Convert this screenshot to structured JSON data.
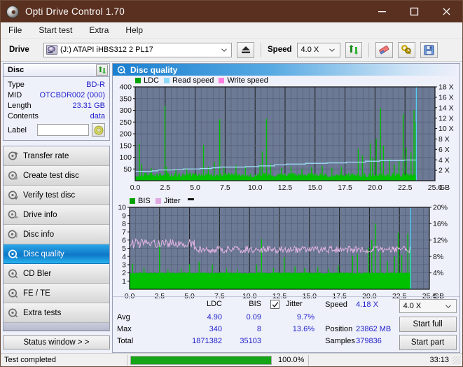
{
  "window": {
    "title": "Opti Drive Control 1.70",
    "icon": "disc-icon",
    "minimize": "minimize-icon",
    "maximize": "maximize-icon",
    "close": "close-icon"
  },
  "menu": {
    "items": [
      "File",
      "Start test",
      "Extra",
      "Help"
    ]
  },
  "toolbar": {
    "drive_label": "Drive",
    "drive_value": "(J:)   ATAPI iHBS312   2 PL17",
    "eject_icon": "eject-icon",
    "speed_label": "Speed",
    "speed_value": "4.0 X",
    "refresh_icon": "refresh-icon",
    "erase_icon": "eraser-icon",
    "tools_icon": "wrench-icon",
    "save_icon": "floppy-save-icon"
  },
  "disc_panel": {
    "title": "Disc",
    "refresh_icon": "refresh-icon",
    "rows": [
      {
        "key": "Type",
        "value": "BD-R"
      },
      {
        "key": "MID",
        "value": "OTCBDR002 (000)"
      },
      {
        "key": "Length",
        "value": "23.31 GB"
      },
      {
        "key": "Contents",
        "value": "data"
      }
    ],
    "label_key": "Label",
    "label_value": "",
    "label_button_icon": "cd-icon"
  },
  "sidebar": {
    "items": [
      {
        "label": "Transfer rate",
        "icon": "disc-transfer-icon",
        "selected": false
      },
      {
        "label": "Create test disc",
        "icon": "disc-create-icon",
        "selected": false
      },
      {
        "label": "Verify test disc",
        "icon": "disc-verify-icon",
        "selected": false
      },
      {
        "label": "Drive info",
        "icon": "disc-drive-icon",
        "selected": false
      },
      {
        "label": "Disc info",
        "icon": "disc-info-icon",
        "selected": false
      },
      {
        "label": "Disc quality",
        "icon": "disc-quality-icon",
        "selected": true
      },
      {
        "label": "CD Bler",
        "icon": "disc-bler-icon",
        "selected": false
      },
      {
        "label": "FE / TE",
        "icon": "disc-fete-icon",
        "selected": false
      },
      {
        "label": "Extra tests",
        "icon": "disc-extra-icon",
        "selected": false
      }
    ],
    "status_button": "Status window > >"
  },
  "main": {
    "header_title": "Disc quality",
    "header_icon": "disc-quality-icon"
  },
  "stats": {
    "col_ldc": "LDC",
    "col_bis": "BIS",
    "jitter_label": "Jitter",
    "jitter_checked": true,
    "rows": [
      {
        "name": "Avg",
        "ldc": "4.90",
        "bis": "0.09",
        "jitter": "9.7%"
      },
      {
        "name": "Max",
        "ldc": "340",
        "bis": "8",
        "jitter": "13.6%"
      },
      {
        "name": "Total",
        "ldc": "1871382",
        "bis": "35103",
        "jitter": ""
      }
    ],
    "speed_label": "Speed",
    "speed_value": "4.18 X",
    "position_label": "Position",
    "position_value": "23862 MB",
    "samples_label": "Samples",
    "samples_value": "379836",
    "speed_select": "4.0 X",
    "start_full": "Start full",
    "start_part": "Start part"
  },
  "statusbar": {
    "text": "Test completed",
    "progress_pct": 100,
    "progress_label": "100.0%",
    "elapsed": "33:13"
  },
  "chart_data": [
    {
      "id": "ldc-chart",
      "type": "line",
      "title": "",
      "xlabel": "GB",
      "ylabel": "",
      "legend": [
        {
          "name": "LDC",
          "color": "#00a000"
        },
        {
          "name": "Read speed",
          "color": "#8ed8f8"
        },
        {
          "name": "Write speed",
          "color": "#ff7fe0"
        }
      ],
      "legend_position": "top-left",
      "grid": true,
      "plot_bg": "#6d7a95",
      "x": [
        0.0,
        2.5,
        5.0,
        7.5,
        10.0,
        12.5,
        15.0,
        17.5,
        20.0,
        22.5,
        25.0
      ],
      "xlim": [
        0,
        25.0
      ],
      "xtick_labels": [
        "0.0",
        "2.5",
        "5.0",
        "7.5",
        "10.0",
        "12.5",
        "15.0",
        "17.5",
        "20.0",
        "22.5",
        "25.0"
      ],
      "ylim": [
        0,
        400
      ],
      "ytick_labels": [
        "50",
        "100",
        "150",
        "200",
        "250",
        "300",
        "350",
        "400"
      ],
      "y2lim": [
        0,
        18
      ],
      "y2tick_labels": [
        "2 X",
        "4 X",
        "6 X",
        "8 X",
        "10 X",
        "12 X",
        "14 X",
        "16 X",
        "18 X"
      ],
      "series": [
        {
          "name": "LDC",
          "color": "#00c000",
          "kind": "spike-fill",
          "baseline_avg": 20,
          "baseline_noise": 22,
          "spikes": [
            {
              "x": 0.35,
              "y": 158
            },
            {
              "x": 0.55,
              "y": 70
            },
            {
              "x": 1.35,
              "y": 55
            },
            {
              "x": 2.48,
              "y": 320
            },
            {
              "x": 2.6,
              "y": 60
            },
            {
              "x": 3.4,
              "y": 48
            },
            {
              "x": 4.3,
              "y": 52
            },
            {
              "x": 5.7,
              "y": 152
            },
            {
              "x": 6.1,
              "y": 60
            },
            {
              "x": 6.6,
              "y": 80
            },
            {
              "x": 7.05,
              "y": 262
            },
            {
              "x": 7.4,
              "y": 58
            },
            {
              "x": 8.4,
              "y": 65
            },
            {
              "x": 9.2,
              "y": 62
            },
            {
              "x": 10.4,
              "y": 70
            },
            {
              "x": 10.6,
              "y": 125
            },
            {
              "x": 10.95,
              "y": 264
            },
            {
              "x": 11.3,
              "y": 72
            },
            {
              "x": 12.2,
              "y": 55
            },
            {
              "x": 13.0,
              "y": 60
            },
            {
              "x": 13.9,
              "y": 50
            },
            {
              "x": 14.7,
              "y": 58
            },
            {
              "x": 15.6,
              "y": 62
            },
            {
              "x": 16.4,
              "y": 55
            },
            {
              "x": 17.2,
              "y": 60
            },
            {
              "x": 18.6,
              "y": 135
            },
            {
              "x": 18.95,
              "y": 108
            },
            {
              "x": 19.6,
              "y": 160
            },
            {
              "x": 19.8,
              "y": 96
            },
            {
              "x": 20.1,
              "y": 180
            },
            {
              "x": 20.45,
              "y": 310
            },
            {
              "x": 20.7,
              "y": 150
            },
            {
              "x": 21.2,
              "y": 92
            },
            {
              "x": 21.6,
              "y": 70
            },
            {
              "x": 22.0,
              "y": 88
            },
            {
              "x": 22.35,
              "y": 285
            },
            {
              "x": 22.6,
              "y": 140
            },
            {
              "x": 23.0,
              "y": 120
            },
            {
              "x": 23.25,
              "y": 300
            },
            {
              "x": 23.4,
              "y": 250
            }
          ]
        },
        {
          "name": "Read speed",
          "color": "#9fdcf8",
          "kind": "step-line",
          "points": [
            {
              "x": 0.0,
              "y": 40
            },
            {
              "x": 1.4,
              "y": 42
            },
            {
              "x": 1.9,
              "y": 46
            },
            {
              "x": 3.2,
              "y": 47
            },
            {
              "x": 4.0,
              "y": 50
            },
            {
              "x": 5.4,
              "y": 52
            },
            {
              "x": 6.4,
              "y": 55
            },
            {
              "x": 7.0,
              "y": 58
            },
            {
              "x": 9.2,
              "y": 60
            },
            {
              "x": 10.3,
              "y": 63
            },
            {
              "x": 11.6,
              "y": 68
            },
            {
              "x": 12.6,
              "y": 71
            },
            {
              "x": 14.2,
              "y": 74
            },
            {
              "x": 16.0,
              "y": 76
            },
            {
              "x": 17.6,
              "y": 79
            },
            {
              "x": 19.2,
              "y": 83
            },
            {
              "x": 20.4,
              "y": 86
            },
            {
              "x": 22.4,
              "y": 88
            },
            {
              "x": 23.4,
              "y": 88
            }
          ]
        },
        {
          "name": "Write speed",
          "color": "#ff7fe0",
          "kind": "none",
          "points": []
        }
      ],
      "cursor": {
        "x": 23.45,
        "color": "#55cdf5"
      }
    },
    {
      "id": "bis-chart",
      "type": "line",
      "title": "",
      "xlabel": "GB",
      "legend": [
        {
          "name": "BIS",
          "color": "#00a000"
        },
        {
          "name": "Jitter",
          "color": "#e0a8e0"
        }
      ],
      "legend_position": "top-left",
      "grid": true,
      "plot_bg": "#6d7a95",
      "xlim": [
        0,
        25.0
      ],
      "xtick_labels": [
        "0.0",
        "2.5",
        "5.0",
        "7.5",
        "10.0",
        "12.5",
        "15.0",
        "17.5",
        "20.0",
        "22.5",
        "25.0"
      ],
      "ylim": [
        0,
        10
      ],
      "ytick_labels": [
        "1",
        "2",
        "3",
        "4",
        "5",
        "6",
        "7",
        "8",
        "9",
        "10"
      ],
      "y2lim": [
        0,
        20
      ],
      "y2tick_labels": [
        "4%",
        "8%",
        "12%",
        "16%",
        "20%"
      ],
      "series": [
        {
          "name": "BIS",
          "color": "#00c000",
          "kind": "spike-fill",
          "baseline_avg": 1.95,
          "baseline_noise": 0.15,
          "spikes": [
            {
              "x": 0.25,
              "y": 3.1
            },
            {
              "x": 1.2,
              "y": 2.6
            },
            {
              "x": 2.5,
              "y": 5.7
            },
            {
              "x": 3.2,
              "y": 2.4
            },
            {
              "x": 4.3,
              "y": 2.5
            },
            {
              "x": 5.0,
              "y": 3.05
            },
            {
              "x": 5.8,
              "y": 3.35
            },
            {
              "x": 6.9,
              "y": 3.0
            },
            {
              "x": 8.1,
              "y": 2.5
            },
            {
              "x": 9.0,
              "y": 2.4
            },
            {
              "x": 10.6,
              "y": 3.0
            },
            {
              "x": 11.0,
              "y": 6.1
            },
            {
              "x": 12.0,
              "y": 2.6
            },
            {
              "x": 12.9,
              "y": 3.9
            },
            {
              "x": 13.8,
              "y": 2.8
            },
            {
              "x": 14.6,
              "y": 2.6
            },
            {
              "x": 15.7,
              "y": 2.7
            },
            {
              "x": 16.6,
              "y": 2.5
            },
            {
              "x": 17.4,
              "y": 2.9
            },
            {
              "x": 18.6,
              "y": 4.1
            },
            {
              "x": 19.0,
              "y": 4.3
            },
            {
              "x": 19.9,
              "y": 5.1
            },
            {
              "x": 20.2,
              "y": 6.0
            },
            {
              "x": 20.5,
              "y": 8.0
            },
            {
              "x": 20.9,
              "y": 4.5
            },
            {
              "x": 21.5,
              "y": 3.4
            },
            {
              "x": 22.1,
              "y": 4.0
            },
            {
              "x": 22.4,
              "y": 6.9
            },
            {
              "x": 22.7,
              "y": 4.2
            },
            {
              "x": 23.2,
              "y": 6.8
            },
            {
              "x": 23.4,
              "y": 5.2
            }
          ]
        },
        {
          "name": "Jitter",
          "color": "#e3b4e3",
          "kind": "noisy-line",
          "segments": [
            {
              "x_from": 0.0,
              "x_to": 5.4,
              "level": 5.6,
              "amp": 0.55
            },
            {
              "x_from": 5.4,
              "x_to": 23.4,
              "level": 4.85,
              "amp": 0.42
            }
          ]
        }
      ],
      "cursor": {
        "x": 23.45,
        "color": "#55cdf5"
      }
    }
  ]
}
